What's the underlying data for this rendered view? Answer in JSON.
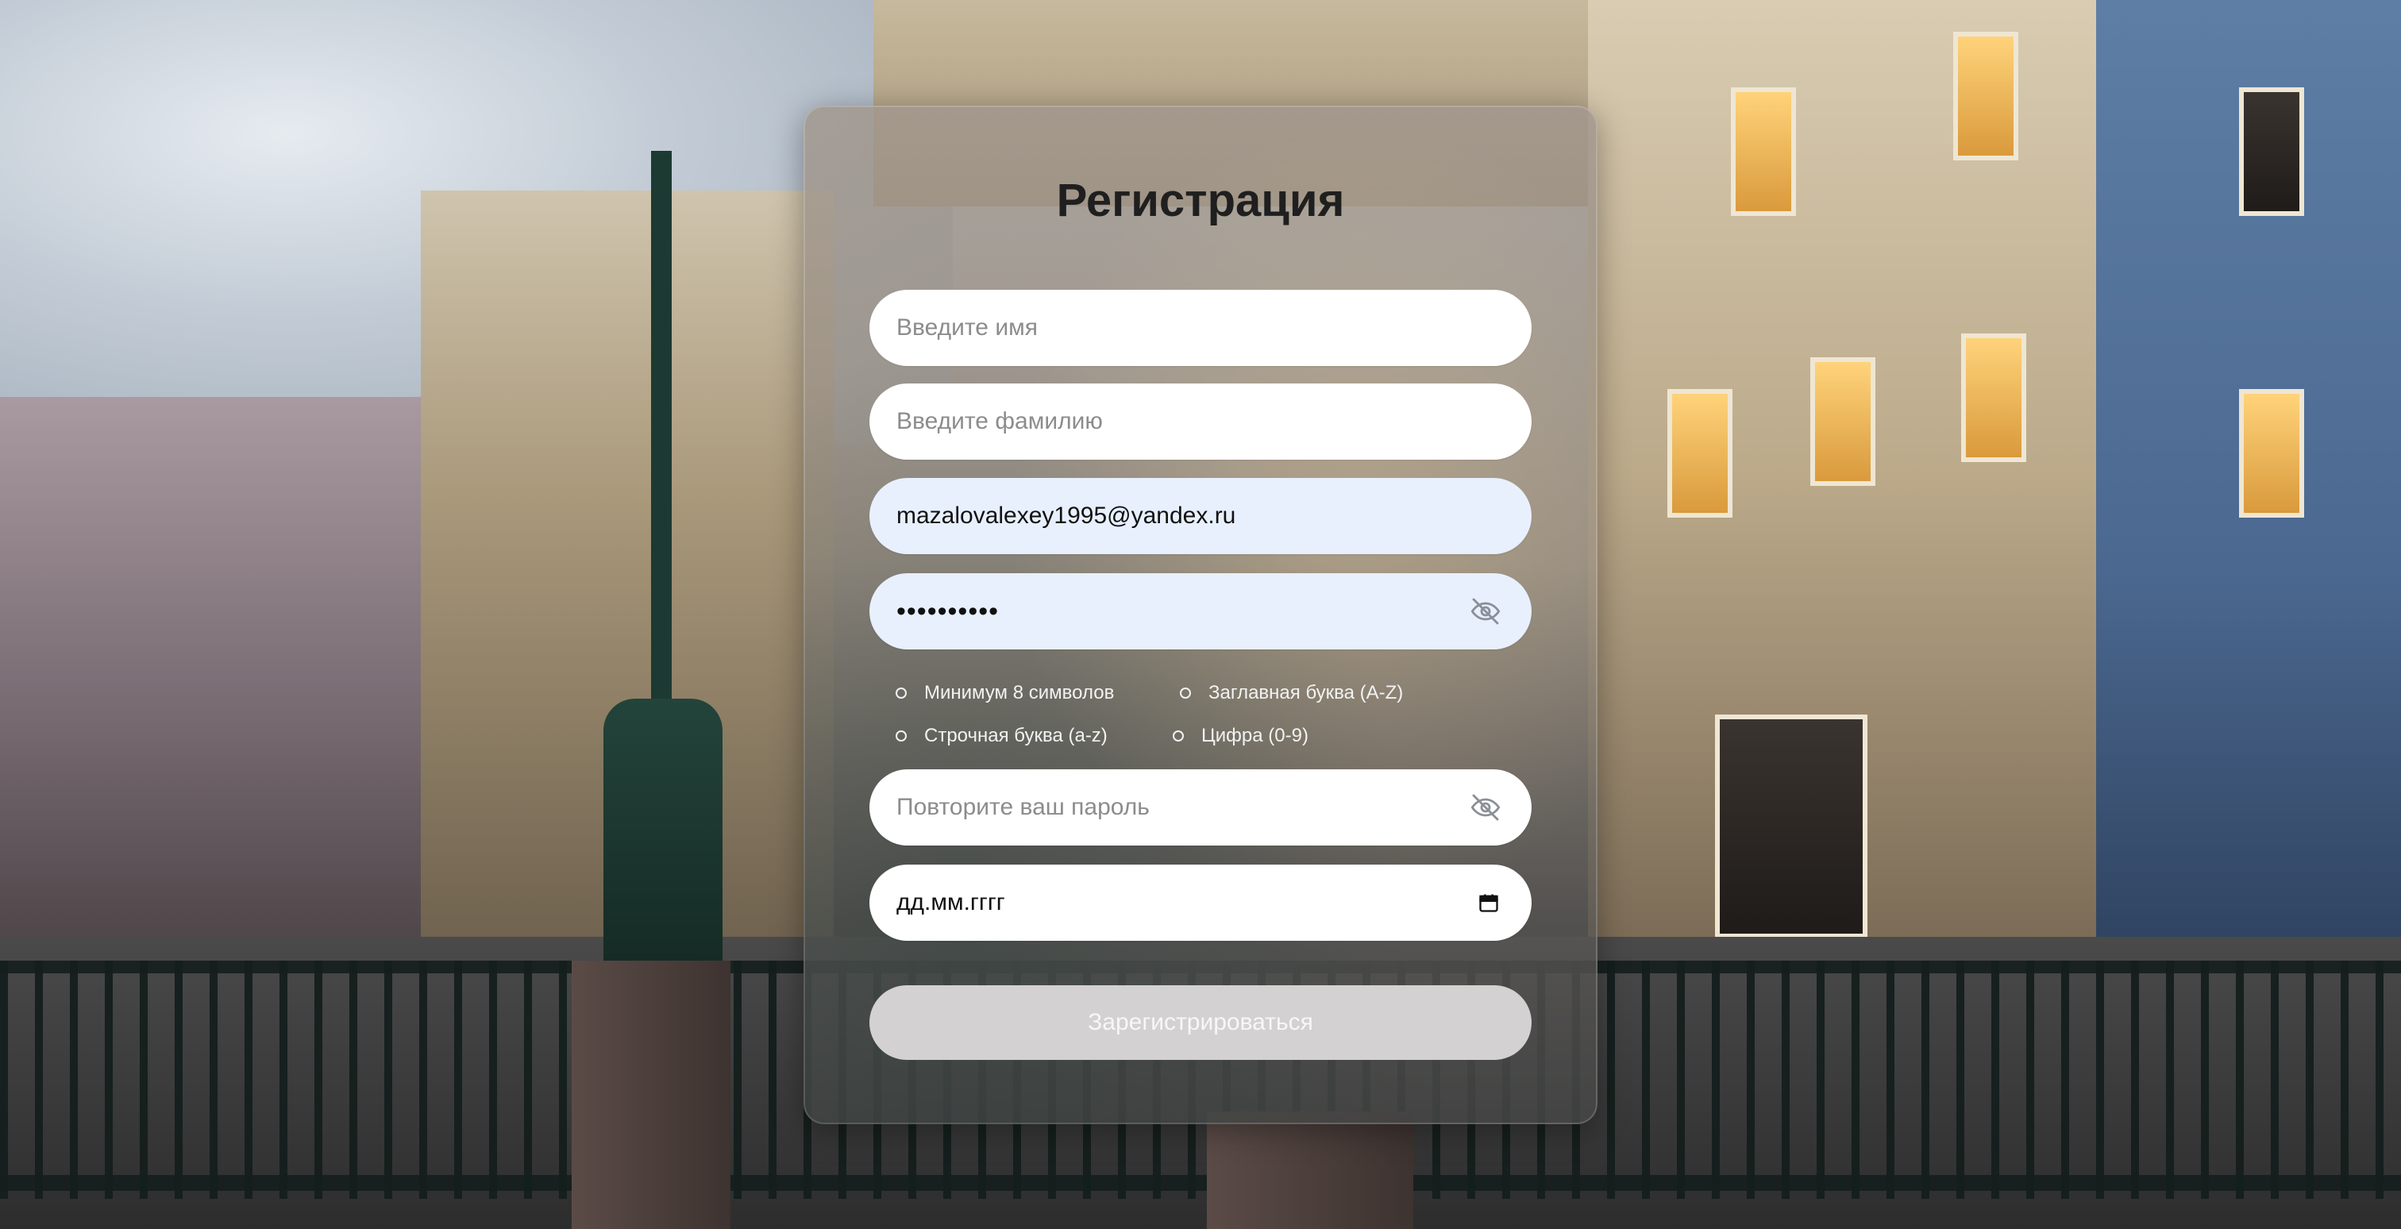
{
  "form": {
    "title": "Регистрация",
    "first_name": {
      "placeholder": "Введите имя",
      "value": ""
    },
    "last_name": {
      "placeholder": "Введите фамилию",
      "value": ""
    },
    "email": {
      "value": "mazalovalexey1995@yandex.ru"
    },
    "password": {
      "masked_value": "••••••••••"
    },
    "requirements": [
      {
        "label": "Минимум 8 символов"
      },
      {
        "label": "Заглавная буква (A-Z)"
      },
      {
        "label": "Строчная буква (a-z)"
      },
      {
        "label": "Цифра (0-9)"
      }
    ],
    "confirm_password": {
      "placeholder": "Повторите ваш пароль",
      "value": ""
    },
    "birth_date": {
      "placeholder": "дд.мм.гггг"
    },
    "submit_label": "Зарегистрироваться"
  },
  "icons": {
    "password_toggle": "eye-off-icon",
    "confirm_toggle": "eye-off-icon",
    "calendar": "calendar-icon"
  },
  "colors": {
    "filled_field_bg": "#e8f0fe",
    "submit_bg": "#d4d1d2",
    "title_color": "#1f1f1f"
  }
}
